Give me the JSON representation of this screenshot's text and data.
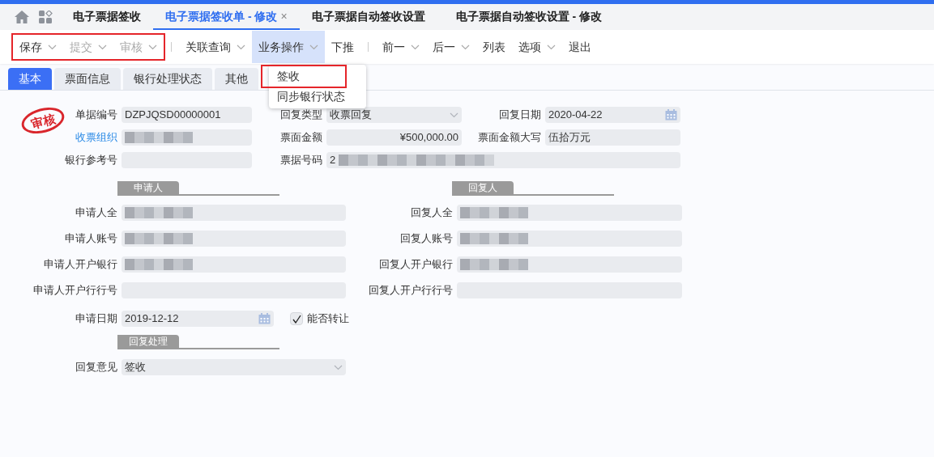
{
  "top_tabs": [
    {
      "label": "电子票据签收",
      "selected": false
    },
    {
      "label": "电子票据签收单 - 修改",
      "selected": true,
      "close_glyph": "×"
    },
    {
      "label": "电子票据自动签收设置",
      "selected": false
    },
    {
      "label": "电子票据自动签收设置 - 修改",
      "selected": false
    }
  ],
  "toolbar": {
    "groups": [
      {
        "annotated": true,
        "items": [
          {
            "label": "保存",
            "disabled": false,
            "has_menu": true,
            "open": false
          },
          {
            "label": "提交",
            "disabled": true,
            "has_menu": true,
            "open": false
          },
          {
            "label": "审核",
            "disabled": true,
            "has_menu": true,
            "open": false
          }
        ]
      },
      {
        "annotated": false,
        "items": [
          {
            "label": "关联查询",
            "disabled": false,
            "has_menu": true,
            "open": false
          },
          {
            "label": "业务操作",
            "disabled": false,
            "has_menu": true,
            "open": true
          },
          {
            "label": "下推",
            "disabled": false,
            "has_menu": false,
            "open": false
          }
        ]
      },
      {
        "annotated": false,
        "items": [
          {
            "label": "前一",
            "disabled": false,
            "has_menu": true,
            "open": false
          },
          {
            "label": "后一",
            "disabled": false,
            "has_menu": true,
            "open": false
          },
          {
            "label": "列表",
            "disabled": false,
            "has_menu": false,
            "open": false
          },
          {
            "label": "选项",
            "disabled": false,
            "has_menu": true,
            "open": false
          },
          {
            "label": "退出",
            "disabled": false,
            "has_menu": false,
            "open": false
          }
        ]
      }
    ]
  },
  "dropdown": {
    "items": [
      {
        "label": "签收",
        "annotated": true
      },
      {
        "label": "同步银行状态",
        "annotated": false
      }
    ]
  },
  "form_tabs": [
    {
      "label": "基本",
      "selected": true
    },
    {
      "label": "票面信息",
      "selected": false
    },
    {
      "label": "银行处理状态",
      "selected": false
    },
    {
      "label": "其他",
      "selected": false
    }
  ],
  "stamp": "审核",
  "header_rows": [
    [
      {
        "label": "单据编号",
        "label_link": false,
        "kind": "text",
        "value": "DZPJQSD00000001",
        "redacted": false
      },
      {
        "label": "回复类型",
        "label_link": false,
        "kind": "select",
        "value": "收票回复",
        "redacted": false
      },
      {
        "label": "回复日期",
        "label_link": false,
        "kind": "date",
        "value": "2020-04-22",
        "redacted": false
      }
    ],
    [
      {
        "label": "收票组织",
        "label_link": true,
        "kind": "text",
        "redacted": true
      },
      {
        "label": "票面金额",
        "label_link": false,
        "kind": "money",
        "value": "¥500,000.00",
        "redacted": false
      },
      {
        "label": "票面金额大写",
        "label_link": false,
        "kind": "text",
        "value": "伍拾万元",
        "redacted": false
      }
    ],
    [
      {
        "label": "银行参考号",
        "label_link": false,
        "kind": "text",
        "redacted": false
      },
      {
        "label": "票据号码",
        "label_link": false,
        "kind": "wide",
        "value": "2",
        "redacted": true
      }
    ]
  ],
  "applicant": {
    "title": "申请人",
    "fields": [
      {
        "label": "申请人全",
        "redacted": true
      },
      {
        "label": "申请人账号",
        "redacted": true
      },
      {
        "label": "申请人开户银行",
        "redacted": true
      },
      {
        "label": "申请人开户行行号",
        "redacted": false
      }
    ]
  },
  "replier": {
    "title": "回复人",
    "fields": [
      {
        "label": "回复人全",
        "redacted": true
      },
      {
        "label": "回复人账号",
        "redacted": true
      },
      {
        "label": "回复人开户银行",
        "redacted": true
      },
      {
        "label": "回复人开户行行号",
        "redacted": false
      }
    ]
  },
  "apply_date": {
    "label": "申请日期",
    "value": "2019-12-12"
  },
  "transferable": {
    "label": "能否转让",
    "checked": true
  },
  "reply_section": {
    "title": "回复处理",
    "label": "回复意见",
    "value": "签收"
  }
}
